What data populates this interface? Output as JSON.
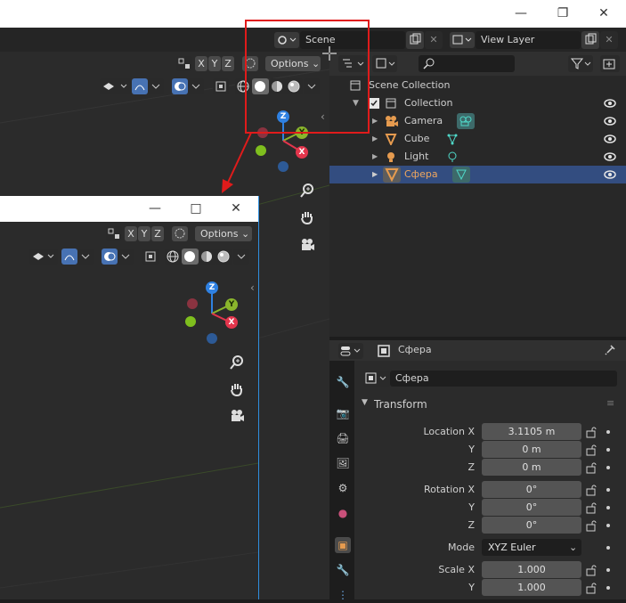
{
  "topbar": {
    "scene_label": "Scene",
    "view_layer_label": "View Layer"
  },
  "viewport": {
    "axes": [
      "X",
      "Y",
      "Z"
    ],
    "options_label": "Options",
    "gizmo": {
      "x": "X",
      "y": "Y",
      "z": "Z"
    }
  },
  "outliner": {
    "search_placeholder": "",
    "items": [
      {
        "label": "Scene Collection"
      },
      {
        "label": "Collection"
      },
      {
        "label": "Camera"
      },
      {
        "label": "Cube"
      },
      {
        "label": "Light"
      },
      {
        "label": "Сфера"
      }
    ]
  },
  "properties": {
    "object_name_header": "Сфера",
    "object_name_field": "Сфера",
    "section_title": "Transform",
    "location_label": "Location X",
    "location": [
      "3.1105 m",
      "0 m",
      "0 m"
    ],
    "rotation_label": "Rotation X",
    "rotation": [
      "0°",
      "0°",
      "0°"
    ],
    "mode_label": "Mode",
    "mode_value": "XYZ Euler",
    "scale_label": "Scale X",
    "scale": [
      "1.000",
      "1.000"
    ],
    "y_label": "Y",
    "z_label": "Z"
  },
  "colors": {
    "selected_row": "#334d80",
    "accent_orange": "#e69b4f",
    "annotation_red": "#e01b1b",
    "window_border": "#2f8fe0"
  }
}
